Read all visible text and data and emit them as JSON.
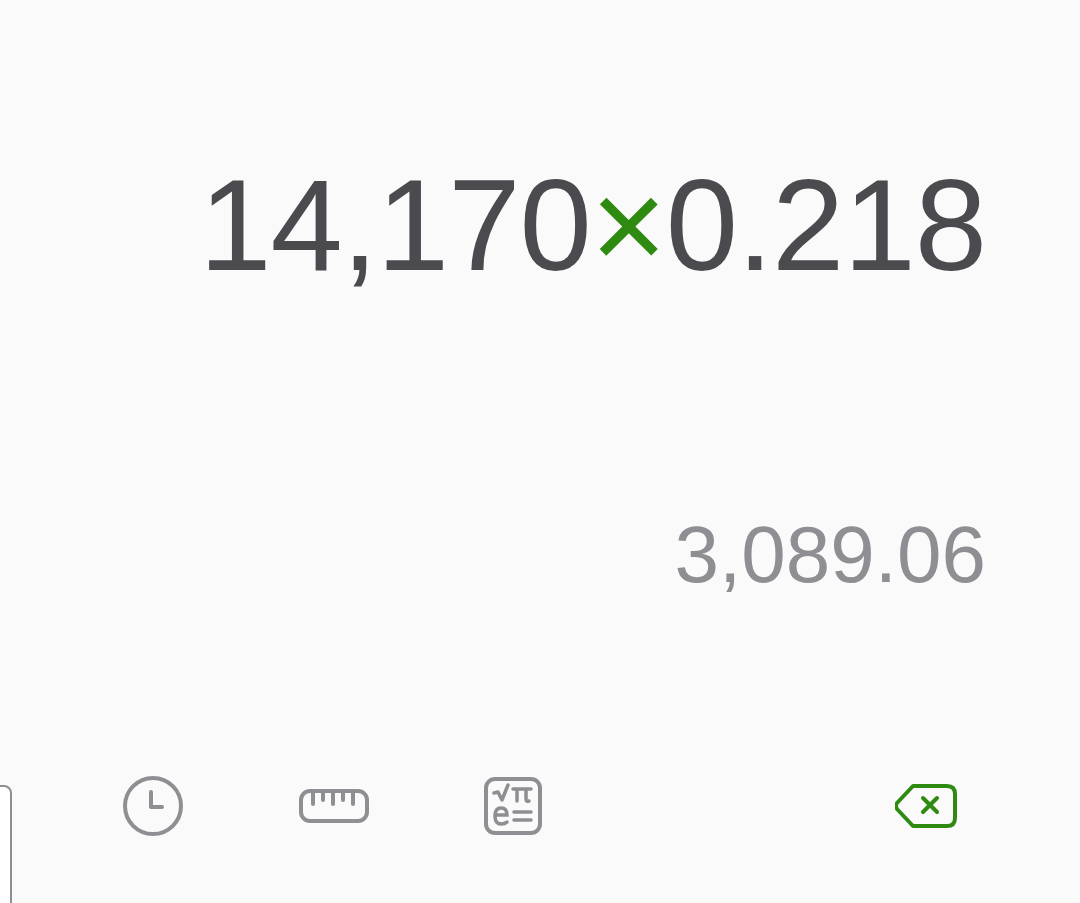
{
  "expression": [
    {
      "kind": "number",
      "text": "14,170"
    },
    {
      "kind": "operator",
      "text": "×"
    },
    {
      "kind": "number",
      "text": "0.218"
    }
  ],
  "result": "3,089.06",
  "toolbar": [
    {
      "kind": "history"
    },
    {
      "kind": "converter"
    },
    {
      "kind": "scientific"
    },
    {
      "kind": "backspace"
    }
  ]
}
